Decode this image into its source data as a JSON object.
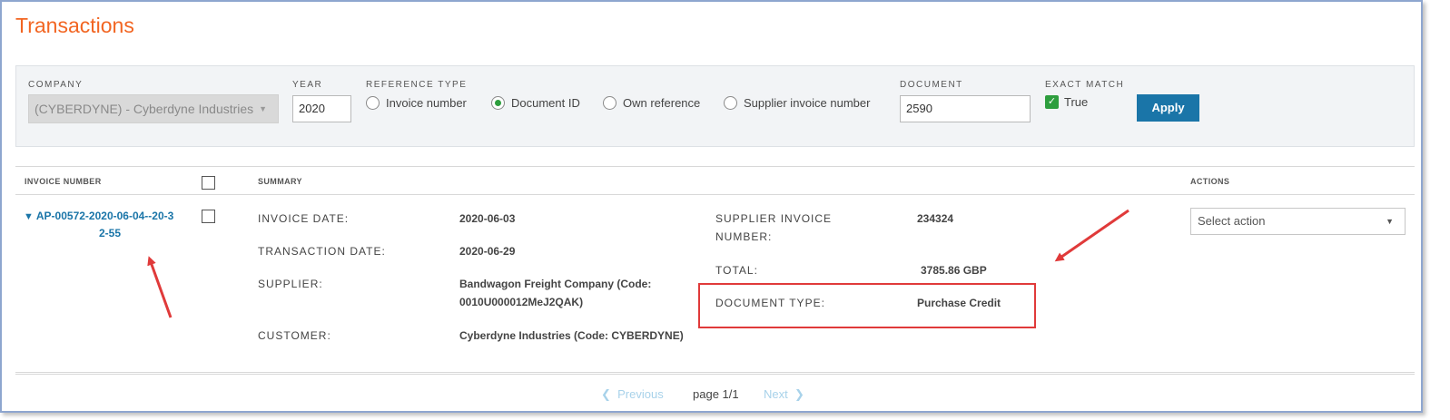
{
  "page": {
    "title": "Transactions"
  },
  "filters": {
    "company_label": "COMPANY",
    "company_value": "(CYBERDYNE) - Cyberdyne Industries",
    "year_label": "YEAR",
    "year_value": "2020",
    "reference_type_label": "REFERENCE TYPE",
    "reference_options": [
      {
        "label": "Invoice number",
        "selected": false
      },
      {
        "label": "Document ID",
        "selected": true
      },
      {
        "label": "Own reference",
        "selected": false
      },
      {
        "label": "Supplier invoice number",
        "selected": false
      }
    ],
    "document_label": "DOCUMENT",
    "document_value": "2590",
    "exact_match_label": "EXACT MATCH",
    "exact_match_value": "True",
    "apply_label": "Apply"
  },
  "table": {
    "headers": {
      "invoice_number": "INVOICE NUMBER",
      "summary": "SUMMARY",
      "actions": "ACTIONS"
    },
    "row": {
      "invoice_number_line1": "AP-00572-2020-06-04--20-3",
      "invoice_number_line2": "2-55",
      "invoice_date_label": "INVOICE DATE:",
      "invoice_date": "2020-06-03",
      "transaction_date_label": "TRANSACTION DATE:",
      "transaction_date": "2020-06-29",
      "supplier_label": "SUPPLIER:",
      "supplier_line1": "Bandwagon Freight Company (Code:",
      "supplier_line2": "0010U000012MeJ2QAK)",
      "customer_label": "CUSTOMER:",
      "customer": "Cyberdyne Industries (Code: CYBERDYNE)",
      "supplier_invoice_number_label_line1": "SUPPLIER INVOICE",
      "supplier_invoice_number_label_line2": "NUMBER:",
      "supplier_invoice_number": "234324",
      "total_label": "TOTAL:",
      "total": "3785.86 GBP",
      "document_type_label": "DOCUMENT TYPE:",
      "document_type": "Purchase Credit",
      "action_placeholder": "Select action"
    }
  },
  "pagination": {
    "previous": "Previous",
    "page": "page 1/1",
    "next": "Next"
  },
  "colors": {
    "title": "#f26522",
    "link": "#1a75a8",
    "apply_button": "#1a75a8",
    "check_green": "#2e9e3e",
    "annotation_red": "#e03a3a"
  },
  "icons": {
    "dropdown": "triangle-down",
    "expand": "chevron-down",
    "prev": "chevron-left",
    "next": "chevron-right",
    "checked": "check"
  }
}
